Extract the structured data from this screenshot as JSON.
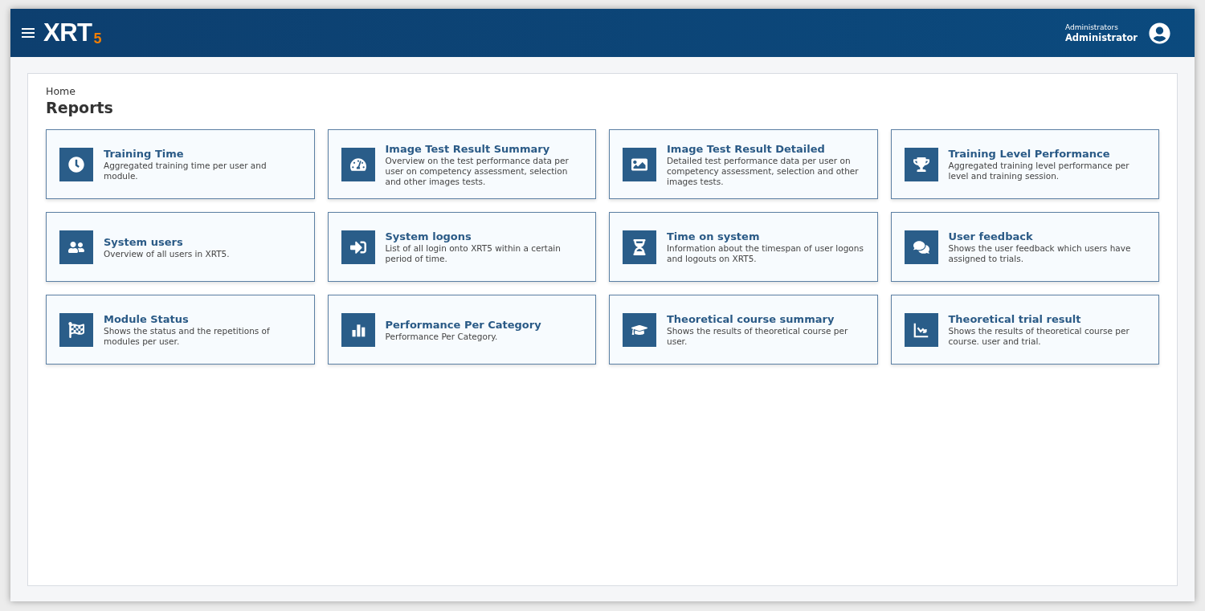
{
  "header": {
    "logo": "XRT",
    "logo_version": "5",
    "user_group": "Administrators",
    "user_name": "Administrator"
  },
  "breadcrumb": "Home",
  "title": "Reports",
  "reports": [
    {
      "title": "Training Time",
      "description": "Aggregated training time per user and module."
    },
    {
      "title": "Image Test Result Summary",
      "description": "Overview on the test performance data per user on competency assessment, selection and other images tests."
    },
    {
      "title": "Image Test Result Detailed",
      "description": "Detailed test performance data per user on competency assessment, selection and other images tests."
    },
    {
      "title": "Training Level Performance",
      "description": "Aggregated training level performance per level and training session."
    },
    {
      "title": "System users",
      "description": "Overview of all users in XRT5."
    },
    {
      "title": "System logons",
      "description": "List of all login onto XRT5 within a certain period of time."
    },
    {
      "title": "Time on system",
      "description": "Information about the timespan of user logons and logouts on XRT5."
    },
    {
      "title": "User feedback",
      "description": "Shows the user feedback which users have assigned to trials."
    },
    {
      "title": "Module Status",
      "description": "Shows the status and the repetitions of modules per user."
    },
    {
      "title": "Performance Per Category",
      "description": "Performance Per Category."
    },
    {
      "title": "Theoretical course summary",
      "description": "Shows the results of theoretical course per user."
    },
    {
      "title": "Theoretical trial result",
      "description": "Shows the results of theoretical course per course. user and trial."
    }
  ]
}
